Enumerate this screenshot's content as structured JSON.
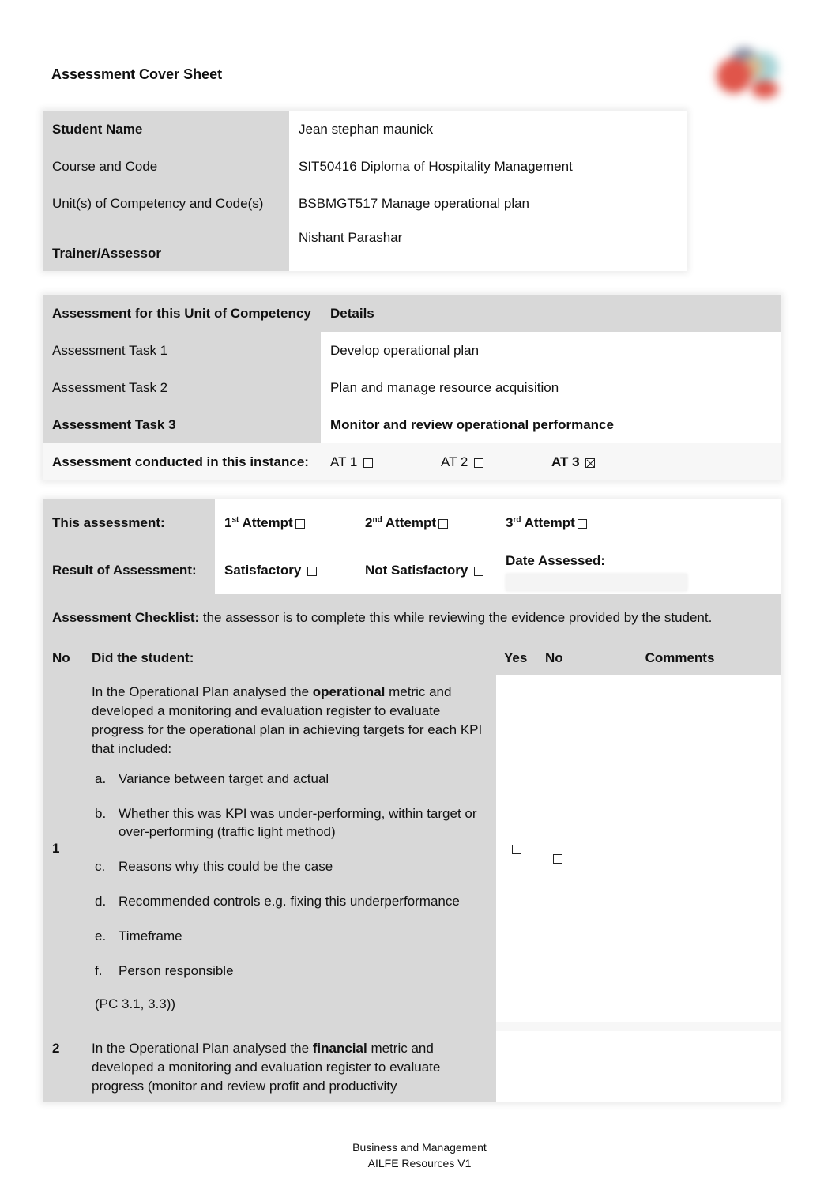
{
  "document": {
    "title": "Assessment Cover Sheet",
    "logo_icon": "organization-logo"
  },
  "student_info": {
    "rows": [
      {
        "label": "Student Name",
        "value": "Jean stephan maunick",
        "bold_label": true
      },
      {
        "label": "Course and Code",
        "value": "SIT50416 Diploma of Hospitality Management",
        "bold_label": false
      },
      {
        "label": "Unit(s) of Competency and Code(s)",
        "value": "BSBMGT517 Manage operational plan",
        "bold_label": false
      },
      {
        "label": "Trainer/Assessor",
        "value": "Nishant Parashar",
        "bold_label": true
      }
    ]
  },
  "assessment_tasks": {
    "header": {
      "col1": "Assessment for this Unit of Competency",
      "col2": "Details"
    },
    "rows": [
      {
        "label": "Assessment Task 1",
        "value": "Develop operational plan"
      },
      {
        "label": "Assessment Task 2",
        "value": "Plan and manage resource acquisition"
      },
      {
        "label": "Assessment Task 3",
        "value": "Monitor and review operational performance"
      }
    ],
    "instance": {
      "label": "Assessment conducted in this instance:",
      "options": [
        {
          "label": "AT 1",
          "checked": false
        },
        {
          "label": "AT 2",
          "checked": false
        },
        {
          "label": "AT 3",
          "checked": true
        }
      ]
    }
  },
  "attempt": {
    "label": "This assessment:",
    "options": [
      {
        "num": "1",
        "sup": "st",
        "text": "Attempt",
        "checked": false
      },
      {
        "num": "2",
        "sup": "nd",
        "text": "Attempt",
        "checked": false
      },
      {
        "num": "3",
        "sup": "rd",
        "text": "Attempt",
        "checked": false
      }
    ]
  },
  "result": {
    "label": "Result of Assessment:",
    "satisfactory": {
      "label": "Satisfactory",
      "checked": false
    },
    "not_satisfactory": {
      "label": "Not Satisfactory",
      "checked": false
    },
    "date_label": "Date Assessed:",
    "date_value": ""
  },
  "checklist": {
    "title_bold": "Assessment Checklist:",
    "title_rest": " the assessor is to complete this while reviewing the evidence provided by the student.",
    "headers": {
      "no": "No",
      "did": "Did the student:",
      "yes": "Yes",
      "no2": "No",
      "comments": "Comments"
    },
    "items": [
      {
        "no": "1",
        "text_pre": "In the Operational Plan analysed the ",
        "text_bold": "operational",
        "text_post": " metric and developed a monitoring and evaluation register to evaluate progress for the operational plan in achieving targets for each KPI that included:",
        "subitems": [
          {
            "marker": "a.",
            "text": "Variance between target and actual"
          },
          {
            "marker": "b.",
            "text": "Whether this was KPI was under-performing, within target or over-performing (traffic light method)"
          },
          {
            "marker": "c.",
            "text": "Reasons why this could be the case"
          },
          {
            "marker": "d.",
            "text": "Recommended controls e.g. fixing this underperformance"
          },
          {
            "marker": "e.",
            "text": "Timeframe"
          },
          {
            "marker": "f.",
            "text": "Person responsible"
          }
        ],
        "pc": "(PC 3.1, 3.3))",
        "yes": false,
        "no_checked": false,
        "comments": ""
      },
      {
        "no": "2",
        "text_pre": "In the Operational Plan analysed the ",
        "text_bold": "financial",
        "text_post": " metric and developed a monitoring and evaluation register to evaluate progress (monitor and review profit and productivity",
        "comments": ""
      }
    ]
  },
  "footer": {
    "line1": "Business and Management",
    "line2": "AILFE Resources V1"
  }
}
